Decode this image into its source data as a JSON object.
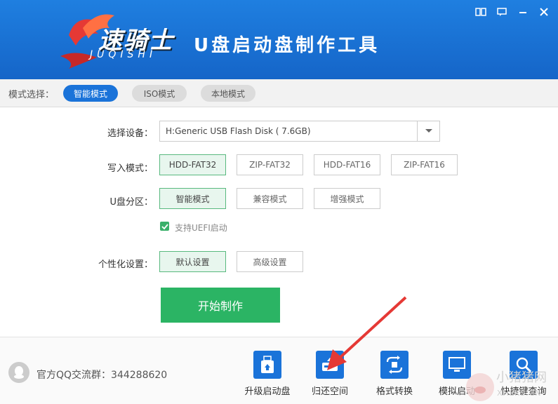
{
  "header": {
    "logo_text": "速骑士",
    "logo_sub": "JUQISHI",
    "title": "U盘启动盘制作工具",
    "window_buttons": [
      "book-icon",
      "message-icon",
      "minimize-icon",
      "close-icon"
    ]
  },
  "modebar": {
    "label": "模式选择：",
    "modes": [
      {
        "label": "智能模式",
        "active": true
      },
      {
        "label": "ISO模式",
        "active": false
      },
      {
        "label": "本地模式",
        "active": false
      }
    ]
  },
  "form": {
    "device_label": "选择设备：",
    "device_value": "H:Generic USB Flash Disk ( 7.6GB)",
    "write_label": "写入模式：",
    "write_options": [
      "HDD-FAT32",
      "ZIP-FAT32",
      "HDD-FAT16",
      "ZIP-FAT16"
    ],
    "partition_label": "U盘分区：",
    "partition_options": [
      "智能模式",
      "兼容模式",
      "增强模式"
    ],
    "uefi_label": "支持UEFI启动",
    "uefi_checked": true,
    "personal_label": "个性化设置：",
    "personal_options": [
      "默认设置",
      "高级设置"
    ],
    "start_label": "开始制作"
  },
  "footer": {
    "qq_text": "官方QQ交流群：344288620",
    "tools": [
      {
        "label": "升级启动盘",
        "icon": "usb-upgrade-icon"
      },
      {
        "label": "归还空间",
        "icon": "disk-restore-icon"
      },
      {
        "label": "格式转换",
        "icon": "convert-icon"
      },
      {
        "label": "模拟启动",
        "icon": "monitor-icon"
      },
      {
        "label": "快捷键查询",
        "icon": "search-icon"
      }
    ]
  },
  "watermark": {
    "text": "小猪猪网",
    "sub": "XHLKS.CN"
  },
  "colors": {
    "header": "#1a6fd6",
    "accent": "#1a73d9",
    "green": "#2bb464",
    "arrow": "#e53935"
  }
}
